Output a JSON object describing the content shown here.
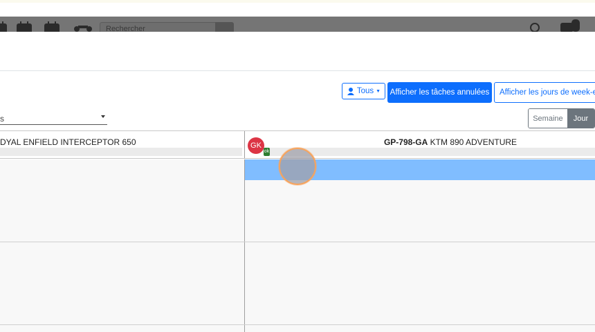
{
  "navbar": {
    "search_placeholder": "Rechercher"
  },
  "toolbar": {
    "filter_label": "Tous",
    "show_cancelled_label": "Afficher les tâches annulées",
    "show_weekend_label": "Afficher les jours de week-end",
    "select_value": "s"
  },
  "view_toggle": {
    "week_label": "Semaine",
    "day_label": "Jour",
    "active": "Jour"
  },
  "columns": [
    {
      "title": "DYAL ENFIELD INTERCEPTOR 650"
    },
    {
      "plate": "GP-798-GA",
      "model": "KTM 890 ADVENTURE",
      "avatar_initials": "GK",
      "badge": "ok"
    }
  ],
  "colors": {
    "primary": "#0d6efd",
    "selection": "#80bdff",
    "avatar": "#dc3545",
    "toggle_active": "#6c757d"
  }
}
